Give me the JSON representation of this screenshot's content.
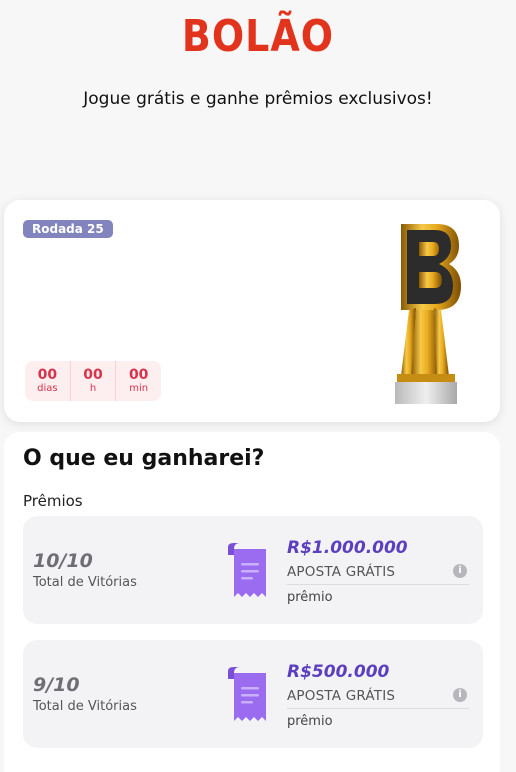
{
  "header": {
    "logo_text": "BOLÃO",
    "tagline": "Jogue grátis e ganhe prêmios exclusivos!"
  },
  "round": {
    "badge": "Rodada 25",
    "countdown": [
      {
        "value": "00",
        "label": "dias"
      },
      {
        "value": "00",
        "label": "h"
      },
      {
        "value": "00",
        "label": "min"
      }
    ]
  },
  "prizes": {
    "title": "O que eu ganharei?",
    "subtitle": "Prêmios",
    "items": [
      {
        "score": "10/10",
        "score_label": "Total de Vitórias",
        "amount": "R$1.000.000",
        "type": "APOSTA GRÁTIS",
        "kind": "prêmio"
      },
      {
        "score": "9/10",
        "score_label": "Total de Vitórias",
        "amount": "R$500.000",
        "type": "APOSTA GRÁTIS",
        "kind": "prêmio"
      }
    ]
  },
  "colors": {
    "brand": "#e2341d",
    "badge": "#8284bd",
    "countdown": "#d8334a",
    "amount": "#5b3fbf",
    "ticket": "#9b6cf0"
  },
  "icons": [
    "trophy-icon",
    "ticket-icon",
    "info-icon"
  ]
}
